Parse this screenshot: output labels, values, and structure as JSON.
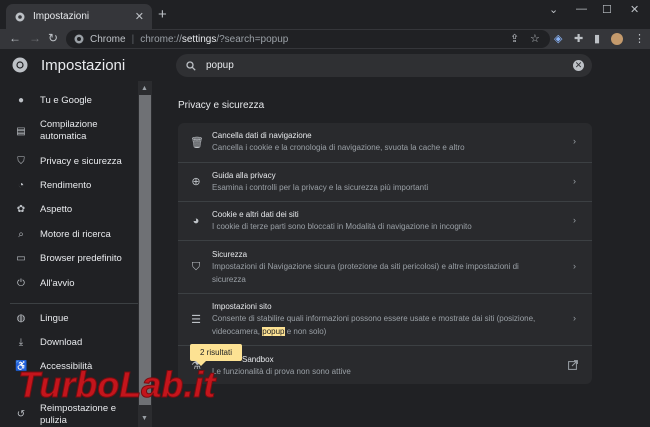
{
  "tab": {
    "title": "Impostazioni",
    "close": "✕",
    "new_tab": "+"
  },
  "window_controls": {
    "menu": "⌄",
    "minimize": "—",
    "maximize": "☐",
    "close": "✕"
  },
  "toolbar": {
    "site_label": "Chrome",
    "url_scheme": "chrome://",
    "url_host": "settings",
    "url_path": "/?search=popup"
  },
  "header": {
    "title": "Impostazioni",
    "search_value": "popup"
  },
  "sidebar": {
    "items": [
      {
        "label": "Tu e Google",
        "icon": "person-icon"
      },
      {
        "label": "Compilazione automatica",
        "icon": "clipboard-icon"
      },
      {
        "label": "Privacy e sicurezza",
        "icon": "shield-icon"
      },
      {
        "label": "Rendimento",
        "icon": "speedometer-icon"
      },
      {
        "label": "Aspetto",
        "icon": "palette-icon"
      },
      {
        "label": "Motore di ricerca",
        "icon": "search-icon"
      },
      {
        "label": "Browser predefinito",
        "icon": "browser-icon"
      },
      {
        "label": "All'avvio",
        "icon": "power-icon"
      },
      {
        "label": "Lingue",
        "icon": "globe-icon"
      },
      {
        "label": "Download",
        "icon": "download-icon"
      },
      {
        "label": "Accessibilità",
        "icon": "accessibility-icon"
      },
      {
        "label": "Reimpostazione e pulizia",
        "icon": "reset-icon"
      }
    ]
  },
  "main": {
    "section_title": "Privacy e sicurezza",
    "rows": [
      {
        "title": "Cancella dati di navigazione",
        "desc": "Cancella i cookie e la cronologia di navigazione, svuota la cache e altro",
        "icon": "trash-icon"
      },
      {
        "title": "Guida alla privacy",
        "desc": "Esamina i controlli per la privacy e la sicurezza più importanti",
        "icon": "add-circle-icon"
      },
      {
        "title": "Cookie e altri dati dei siti",
        "desc": "I cookie di terze parti sono bloccati in Modalità di navigazione in incognito",
        "icon": "cookie-icon"
      },
      {
        "title": "Sicurezza",
        "desc": "Impostazioni di Navigazione sicura (protezione da siti pericolosi) e altre impostazioni di sicurezza",
        "icon": "shield-icon"
      },
      {
        "title": "Impostazioni sito",
        "desc_before": "Consente di stabilire quali informazioni possono essere usate e mostrate dai siti (posizione, videocamera, ",
        "desc_highlight": "popup",
        "desc_after": " e non solo)",
        "icon": "tune-icon"
      },
      {
        "title": "Privacy Sandbox",
        "title_visible": "Sandbox",
        "desc": "Le funzionalità di prova non sono attive",
        "icon": "flask-icon"
      }
    ],
    "tooltip": "2 risultati"
  },
  "watermark": {
    "text": "TurboLab.it"
  },
  "colors": {
    "background": "#202124",
    "card": "#292a2d",
    "highlight": "#fde293",
    "accent": "#8ab4f8"
  }
}
